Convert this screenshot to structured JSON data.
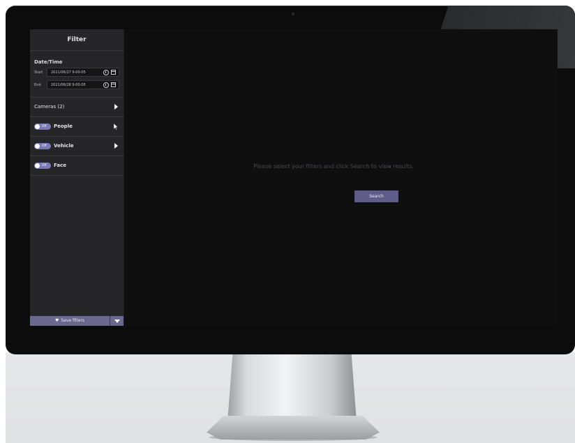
{
  "sidebar": {
    "title": "Filter",
    "date_time": {
      "label": "Date/Time",
      "start_label": "Start",
      "start_value": "2021/06/27  9:00:05",
      "end_label": "End",
      "end_value": "2021/06/28  9:00:05"
    },
    "cameras_label": "Cameras (2)",
    "toggles": [
      {
        "label": "People",
        "state": "Off"
      },
      {
        "label": "Vehicle",
        "state": "Off"
      },
      {
        "label": "Face",
        "state": "Off"
      }
    ],
    "save_filters_label": "Save filters"
  },
  "main": {
    "message": "Please select your filters and click Search to view results.",
    "search_label": "Search"
  },
  "colors": {
    "accent": "#7b78b8",
    "button": "#5f5c8a",
    "panel": "#262628",
    "background": "#0f0f10"
  }
}
